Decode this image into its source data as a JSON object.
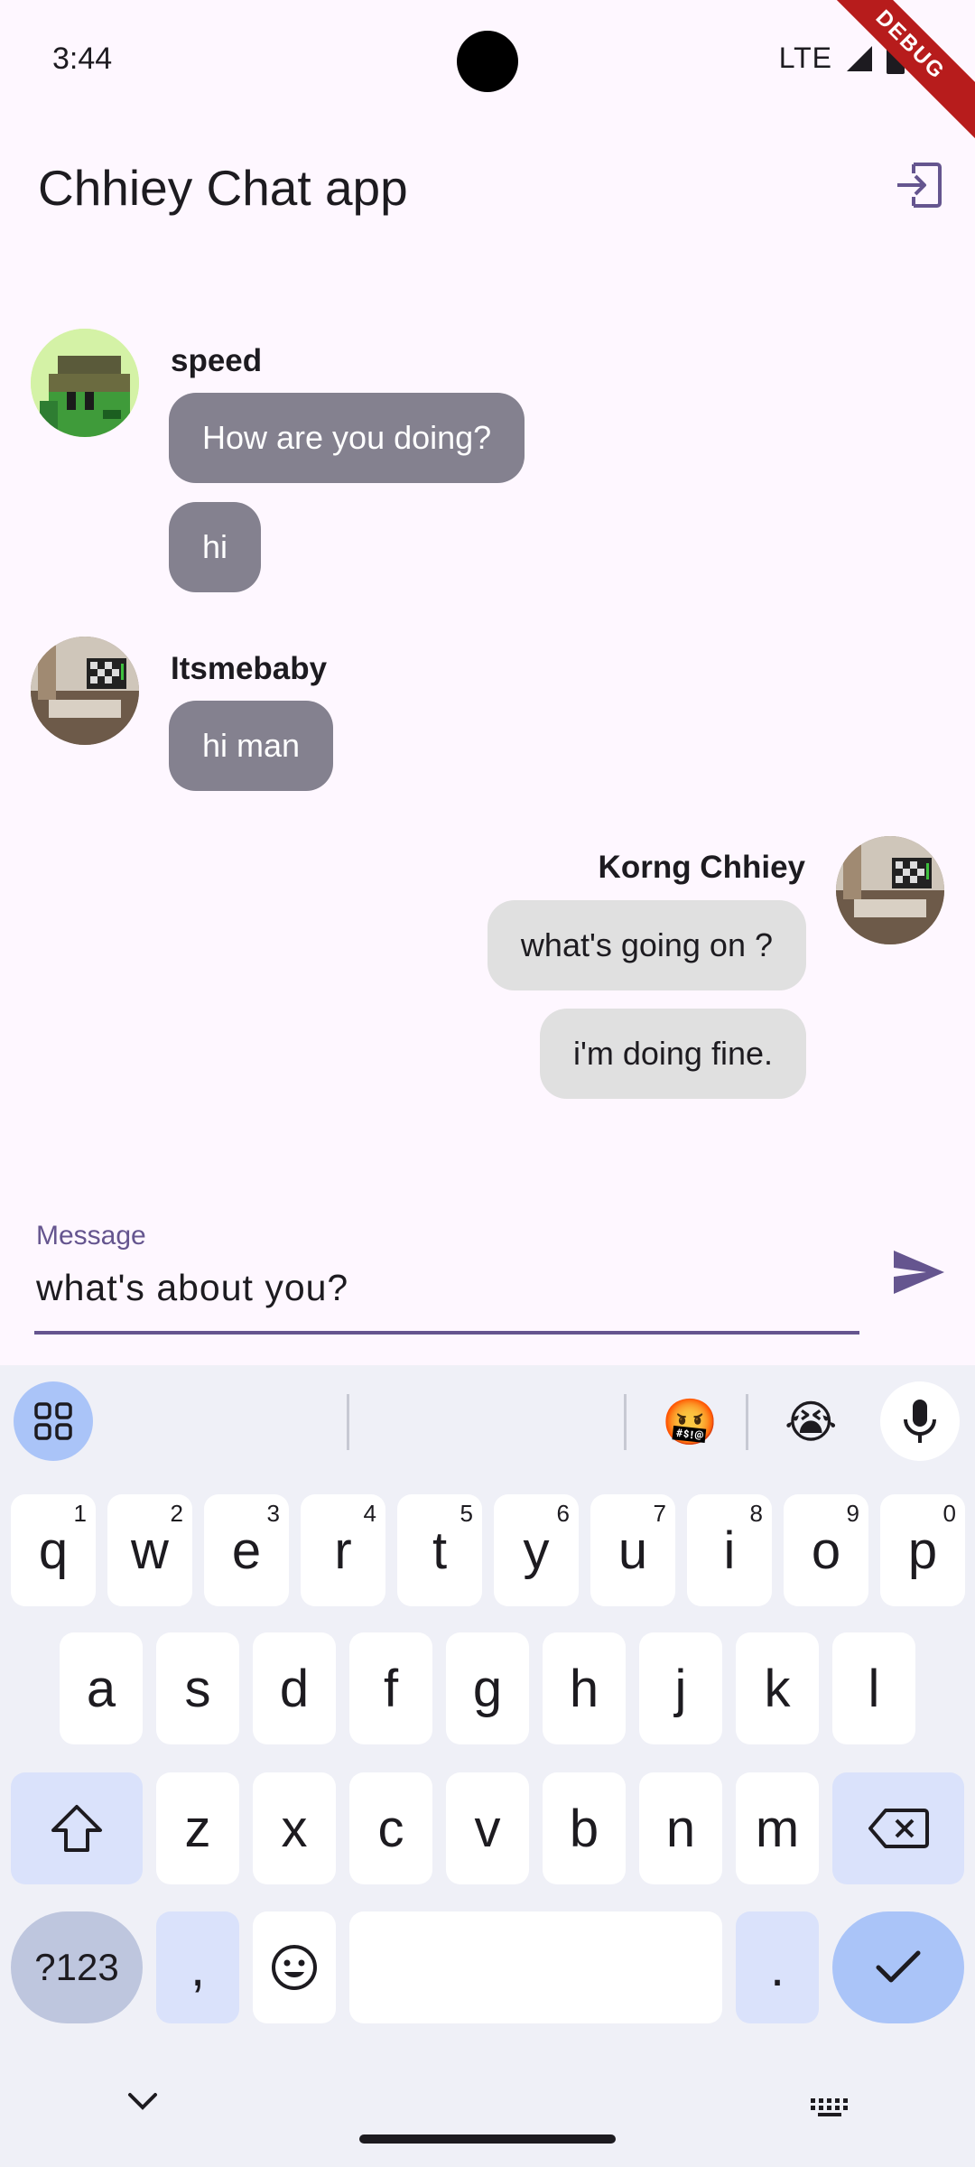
{
  "status_bar": {
    "time": "3:44",
    "network": "LTE",
    "debug_label": "DEBUG"
  },
  "app_bar": {
    "title": "Chhiey Chat app",
    "logout_icon": "logout-icon"
  },
  "messages": [
    {
      "sender": "speed",
      "side": "left",
      "avatar": "pixel-art-avatar",
      "bubbles": [
        "How are you doing?",
        "hi"
      ]
    },
    {
      "sender": "Itsmebaby",
      "side": "left",
      "avatar": "room-photo-avatar",
      "bubbles": [
        "hi man"
      ]
    },
    {
      "sender": "Korng Chhiey",
      "side": "right",
      "avatar": "room-photo-avatar",
      "bubbles": [
        "what's going on ?",
        "i'm doing fine."
      ]
    }
  ],
  "composer": {
    "label": "Message",
    "value": "what's about you?",
    "send_icon": "send-icon"
  },
  "keyboard": {
    "toolbar": {
      "emoji_1": "🤬",
      "emoji_2": "😭"
    },
    "row1": [
      {
        "k": "q",
        "h": "1"
      },
      {
        "k": "w",
        "h": "2"
      },
      {
        "k": "e",
        "h": "3"
      },
      {
        "k": "r",
        "h": "4"
      },
      {
        "k": "t",
        "h": "5"
      },
      {
        "k": "y",
        "h": "6"
      },
      {
        "k": "u",
        "h": "7"
      },
      {
        "k": "i",
        "h": "8"
      },
      {
        "k": "o",
        "h": "9"
      },
      {
        "k": "p",
        "h": "0"
      }
    ],
    "row2": [
      "a",
      "s",
      "d",
      "f",
      "g",
      "h",
      "j",
      "k",
      "l"
    ],
    "row3": [
      "z",
      "x",
      "c",
      "v",
      "b",
      "n",
      "m"
    ],
    "symbols_key": "?123",
    "comma_key": ",",
    "period_key": "."
  },
  "colors": {
    "accent": "#65558f",
    "incoming_bubble": "#84818f",
    "outgoing_bubble": "#e0e0e0",
    "background": "#fef7ff"
  }
}
